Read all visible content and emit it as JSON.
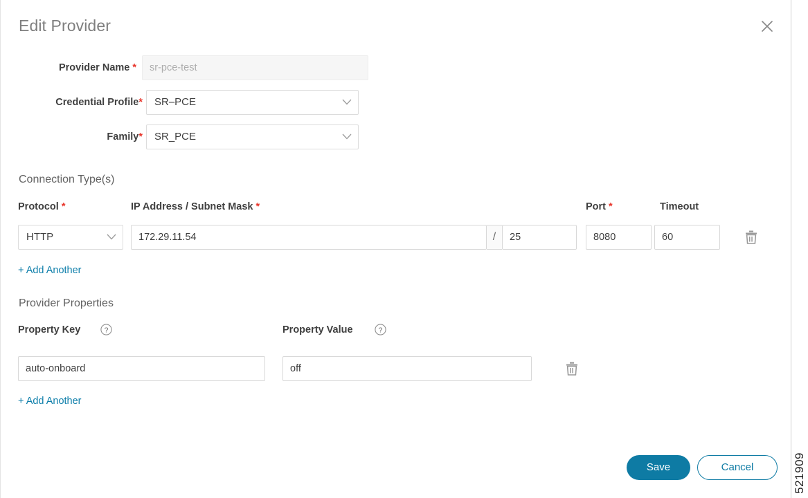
{
  "dialog": {
    "title": "Edit Provider",
    "close_icon": "close-icon"
  },
  "fields": {
    "provider_name": {
      "label": "Provider Name",
      "required_mark": "*",
      "value": "sr-pce-test",
      "disabled": true
    },
    "credential_profile": {
      "label": "Credential Profile",
      "required_mark": "*",
      "value": "SR–PCE"
    },
    "family": {
      "label": "Family",
      "required_mark": "*",
      "value": "SR_PCE"
    }
  },
  "connection_types": {
    "heading": "Connection Type(s)",
    "columns": {
      "protocol": "Protocol",
      "protocol_required": "*",
      "ip_subnet": "IP Address / Subnet Mask",
      "ip_subnet_required": "*",
      "port": "Port",
      "port_required": "*",
      "timeout": "Timeout"
    },
    "rows": [
      {
        "protocol": "HTTP",
        "ip_address": "172.29.11.54",
        "separator": "/",
        "subnet_mask": "25",
        "port": "8080",
        "timeout": "60",
        "delete_icon": "trash-icon"
      }
    ],
    "add_another": "+ Add Another"
  },
  "provider_properties": {
    "heading": "Provider Properties",
    "columns": {
      "property_key": "Property Key",
      "property_key_help": "?",
      "property_value": "Property Value",
      "property_value_help": "?"
    },
    "rows": [
      {
        "key": "auto-onboard",
        "value": "off",
        "delete_icon": "trash-icon"
      }
    ],
    "add_another": "+ Add Another"
  },
  "footer": {
    "save_label": "Save",
    "cancel_label": "Cancel"
  },
  "figure_number": "521909",
  "colors": {
    "accent": "#0e7ba4",
    "required": "#e8382e",
    "link": "#0d7eaa",
    "title": "#7f7f7f"
  }
}
